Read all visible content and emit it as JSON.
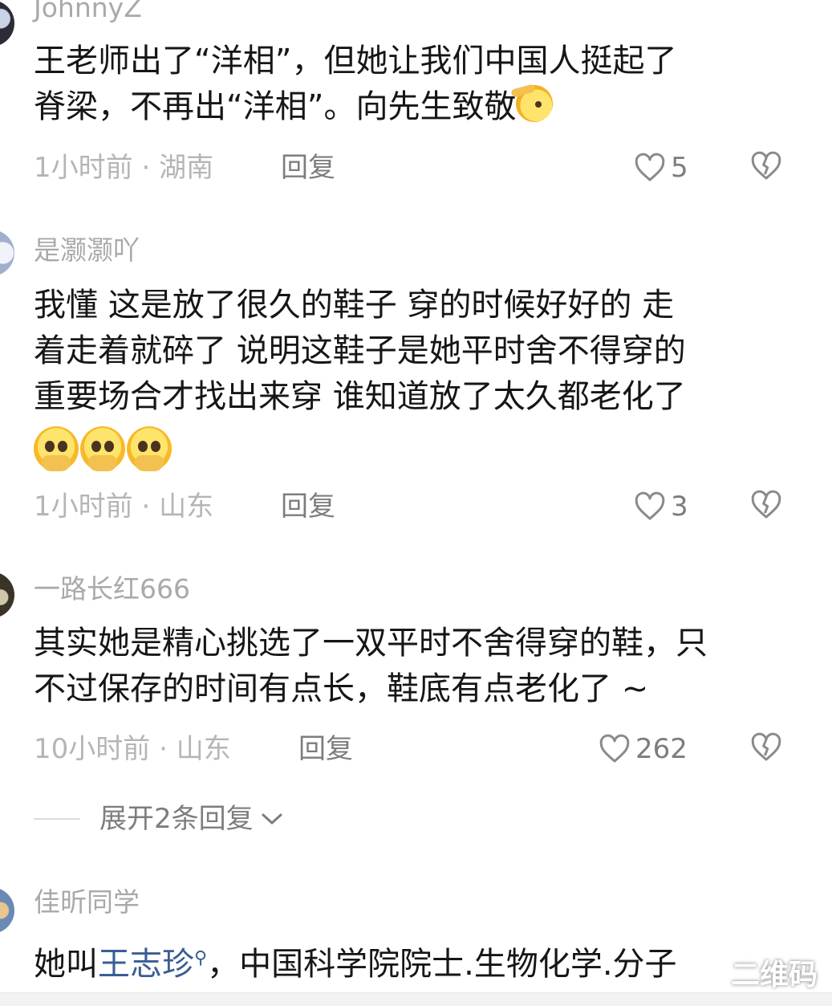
{
  "comments": [
    {
      "username": "JohnnyZ",
      "text": "王老师出了“洋相”，但她让我们中国人挺起了\n脊梁，不再出“洋相”。向先生致敬",
      "time": "1小时前",
      "sep": "·",
      "location": "湖南",
      "reply": "回复",
      "likes": "5"
    },
    {
      "username": "是灏灏吖",
      "text": "我懂  这是放了很久的鞋子  穿的时候好好的  走\n着走着就碎了  说明这鞋子是她平时舍不得穿的\n重要场合才找出来穿  谁知道放了太久都老化了",
      "time": "1小时前",
      "sep": "·",
      "location": "山东",
      "reply": "回复",
      "likes": "3"
    },
    {
      "username": "一路长红666",
      "text": "其实她是精心挑选了一双平时不舍得穿的鞋，只\n不过保存的时间有点长，鞋底有点老化了 ~",
      "time": "10小时前",
      "sep": "·",
      "location": "山东",
      "reply": "回复",
      "likes": "262"
    },
    {
      "username": "佳昕同学",
      "text_before": "她叫",
      "link": "王志珍",
      "text_after": "，中国科学院院士.生物化学.分子"
    }
  ],
  "expand_replies": "展开2条回复",
  "watermark": "二维码",
  "icons": {
    "like": "heart-outline-icon",
    "dislike": "broken-heart-icon",
    "expand": "chevron-down-icon",
    "search": "magnifier-icon",
    "emoji_salute": "saluting-face-emoji",
    "emoji_holding_tears": "face-holding-back-tears-emoji"
  },
  "colors": {
    "text": "#161616",
    "meta": "#b5b5b5",
    "action": "#7d7d7d",
    "link": "#3a5d96"
  }
}
